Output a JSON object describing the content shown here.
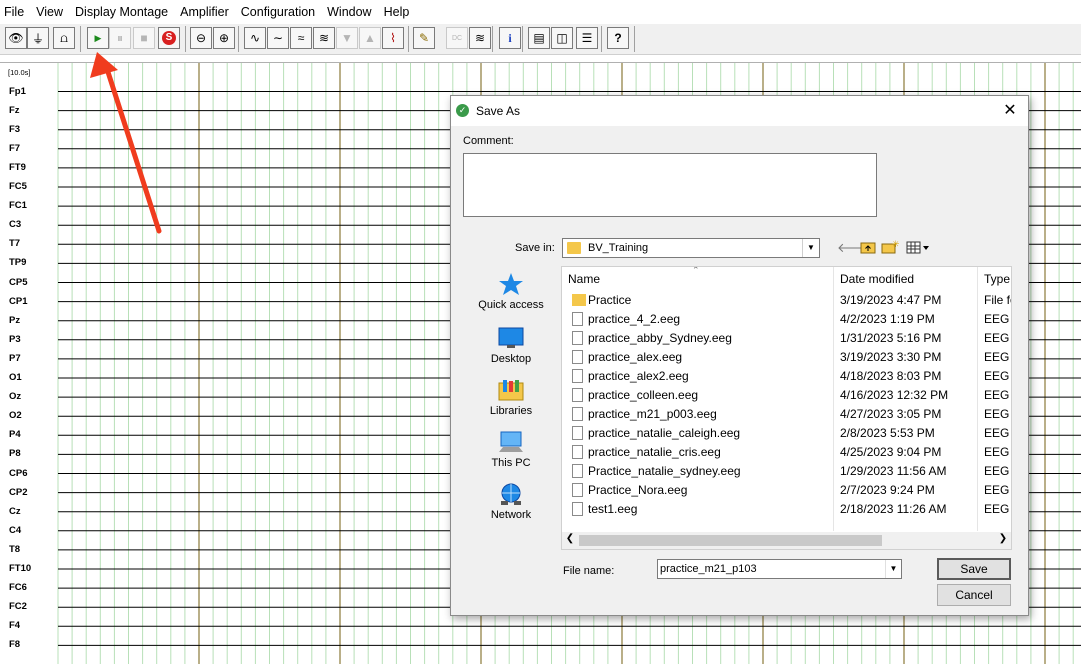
{
  "menu": [
    "File",
    "View",
    "Display Montage",
    "Amplifier",
    "Configuration",
    "Window",
    "Help"
  ],
  "toolbar": {
    "buttons": [
      {
        "icon": "eye-icon",
        "glyph": "👁"
      },
      {
        "icon": "electrode-icon",
        "glyph": "⏚"
      },
      {
        "icon": "impedance-icon",
        "glyph": "⩍"
      },
      {
        "icon": "play-icon",
        "glyph": "▶"
      },
      {
        "icon": "pause-icon",
        "glyph": "⏸"
      },
      {
        "icon": "stop-icon",
        "glyph": "■"
      },
      {
        "icon": "record-icon",
        "glyph": "S"
      },
      {
        "icon": "zoom-out-icon",
        "glyph": "⊖"
      },
      {
        "icon": "zoom-in-icon",
        "glyph": "⊕"
      },
      {
        "icon": "scale-up-icon",
        "glyph": "∿"
      },
      {
        "icon": "scale-down-icon",
        "glyph": "∼"
      },
      {
        "icon": "baseline-icon",
        "glyph": "≈"
      },
      {
        "icon": "filter-icon",
        "glyph": "≋"
      },
      {
        "icon": "channels-down-icon",
        "glyph": "▼"
      },
      {
        "icon": "channels-up-icon",
        "glyph": "▲"
      },
      {
        "icon": "marker-icon",
        "glyph": "⌇"
      },
      {
        "icon": "pencil-icon",
        "glyph": "✎"
      },
      {
        "icon": "dc-correction-icon",
        "glyph": "DC"
      },
      {
        "icon": "waves-icon",
        "glyph": "≋"
      },
      {
        "icon": "info-icon",
        "glyph": "i"
      },
      {
        "icon": "layout-1-icon",
        "glyph": "▤"
      },
      {
        "icon": "layout-2-icon",
        "glyph": "◫"
      },
      {
        "icon": "layout-3-icon",
        "glyph": "☰"
      },
      {
        "icon": "help-icon",
        "glyph": "?"
      }
    ]
  },
  "eeg": {
    "time_scale": "[10.0s]",
    "channels": [
      "Fp1",
      "Fz",
      "F3",
      "F7",
      "FT9",
      "FC5",
      "FC1",
      "C3",
      "T7",
      "TP9",
      "CP5",
      "CP1",
      "Pz",
      "P3",
      "P7",
      "O1",
      "Oz",
      "O2",
      "P4",
      "P8",
      "CP6",
      "CP2",
      "Cz",
      "C4",
      "T8",
      "FT10",
      "FC6",
      "FC2",
      "F4",
      "F8"
    ]
  },
  "dialog": {
    "title": "Save As",
    "comment_label": "Comment:",
    "comment_value": "",
    "save_in_label": "Save in:",
    "save_in_value": "BV_Training",
    "places": [
      {
        "label": "Quick access",
        "icon": "quick-access-star-icon"
      },
      {
        "label": "Desktop",
        "icon": "desktop-icon"
      },
      {
        "label": "Libraries",
        "icon": "libraries-icon"
      },
      {
        "label": "This PC",
        "icon": "this-pc-icon"
      },
      {
        "label": "Network",
        "icon": "network-icon"
      }
    ],
    "columns": {
      "name": "Name",
      "date": "Date modified",
      "type": "Type"
    },
    "files": [
      {
        "name": "Practice",
        "date": "3/19/2023 4:47 PM",
        "type": "File fo",
        "folder": true
      },
      {
        "name": "practice_4_2.eeg",
        "date": "4/2/2023 1:19 PM",
        "type": "EEG F"
      },
      {
        "name": "practice_abby_Sydney.eeg",
        "date": "1/31/2023 5:16 PM",
        "type": "EEG F"
      },
      {
        "name": "practice_alex.eeg",
        "date": "3/19/2023 3:30 PM",
        "type": "EEG F"
      },
      {
        "name": "practice_alex2.eeg",
        "date": "4/18/2023 8:03 PM",
        "type": "EEG F"
      },
      {
        "name": "practice_colleen.eeg",
        "date": "4/16/2023 12:32 PM",
        "type": "EEG F"
      },
      {
        "name": "practice_m21_p003.eeg",
        "date": "4/27/2023 3:05 PM",
        "type": "EEG F"
      },
      {
        "name": "practice_natalie_caleigh.eeg",
        "date": "2/8/2023 5:53 PM",
        "type": "EEG F"
      },
      {
        "name": "practice_natalie_cris.eeg",
        "date": "4/25/2023 9:04 PM",
        "type": "EEG F"
      },
      {
        "name": "Practice_natalie_sydney.eeg",
        "date": "1/29/2023 11:56 AM",
        "type": "EEG F"
      },
      {
        "name": "Practice_Nora.eeg",
        "date": "2/7/2023 9:24 PM",
        "type": "EEG F"
      },
      {
        "name": "test1.eeg",
        "date": "2/18/2023 11:26 AM",
        "type": "EEG F"
      }
    ],
    "file_name_label": "File name:",
    "file_name_value": "practice_m21_p103",
    "save_label": "Save",
    "cancel_label": "Cancel"
  },
  "colors": {
    "annotation_arrow": "#f03c1e",
    "major_grid": "#8b7a3a",
    "minor_grid": "#b8e0b8",
    "trace": "#000000"
  }
}
